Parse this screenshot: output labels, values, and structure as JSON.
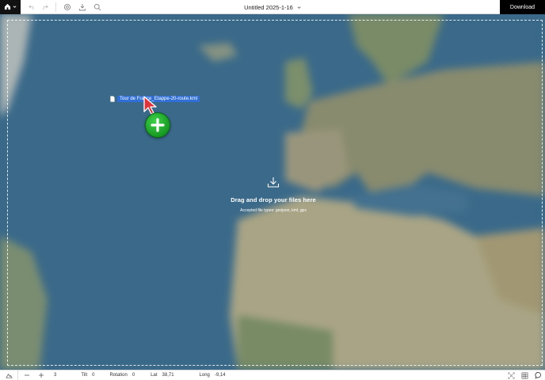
{
  "toolbar": {
    "title": "Untitled 2025-1-16",
    "download_label": "Download",
    "icons": [
      "home-icon",
      "chevron-down-icon",
      "undo-icon",
      "redo-icon",
      "settings-icon",
      "download-icon",
      "search-icon"
    ]
  },
  "drag": {
    "file_name": "Tour de France_Etappe-20-route.kml"
  },
  "drop_zone": {
    "title": "Drag and drop your files here",
    "subtitle": "Accepted file types: geojson, kml, gpx"
  },
  "status": {
    "zoom": "3",
    "tilt_label": "Tilt",
    "tilt": "0",
    "rotation_label": "Rotation",
    "rotation": "0",
    "lat_label": "Lat",
    "lat": "38,71",
    "long_label": "Long",
    "long": "-9,14"
  },
  "colors": {
    "ocean": "#3f7193",
    "land": "#a8a180",
    "accent": "#2f6fd6",
    "plus_green": "#1fb02c",
    "cursor_red": "#e0333c"
  }
}
